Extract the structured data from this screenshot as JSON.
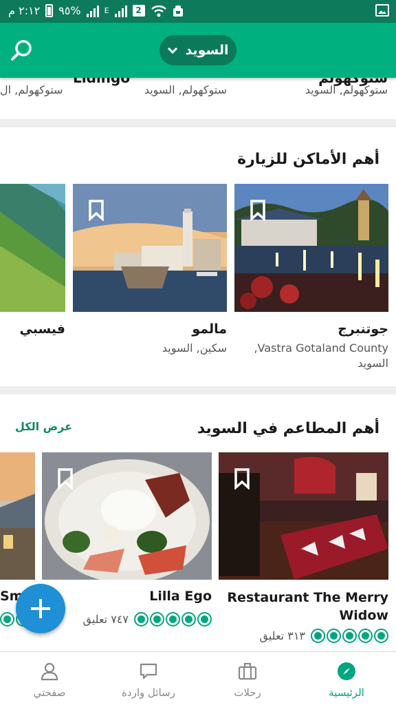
{
  "status_bar": {
    "time": "٢:١٢ م",
    "battery": "٩٥%",
    "network_label": "E",
    "sim_slot": "2"
  },
  "app_bar": {
    "country_label": "السويد"
  },
  "previous_row": {
    "items": [
      {
        "title": "Lidingo",
        "subtitle": "ستوكهولم, السويد"
      },
      {
        "title": "ستوكهولم",
        "subtitle": "ستوكهولم, السويد"
      },
      {
        "title": "",
        "subtitle": "ستوكهولم, ال"
      }
    ]
  },
  "places_section": {
    "title": "أهم الأماكن للزيارة",
    "cards": [
      {
        "title": "جوتنبرج",
        "subtitle": "Vastra Gotaland County, السويد"
      },
      {
        "title": "مالمو",
        "subtitle": "سكين, السويد"
      },
      {
        "title": "فيسبي",
        "subtitle": ""
      }
    ]
  },
  "restaurants_section": {
    "title": "أهم المطاعم في السويد",
    "view_all": "عرض الكل",
    "cards": [
      {
        "title": "Restaurant The Merry Widow",
        "rating": 5,
        "reviews": "٣١٣ تعليق"
      },
      {
        "title": "Lilla Ego",
        "rating": 5,
        "reviews": "٧٤٧ تعليق"
      },
      {
        "title": "Smeskr",
        "rating": 5,
        "reviews": ""
      }
    ]
  },
  "bottom_nav": {
    "items": [
      {
        "label": "الرئيسية",
        "icon": "compass-icon",
        "active": true
      },
      {
        "label": "رحلات",
        "icon": "suitcase-icon",
        "active": false
      },
      {
        "label": "رسائل واردة",
        "icon": "message-icon",
        "active": false
      },
      {
        "label": "صفحتي",
        "icon": "profile-icon",
        "active": false
      }
    ]
  },
  "colors": {
    "brand": "#00b07f",
    "status_bar": "#0e7a5c",
    "rating": "#00a680",
    "fab": "#1f8fd6"
  }
}
